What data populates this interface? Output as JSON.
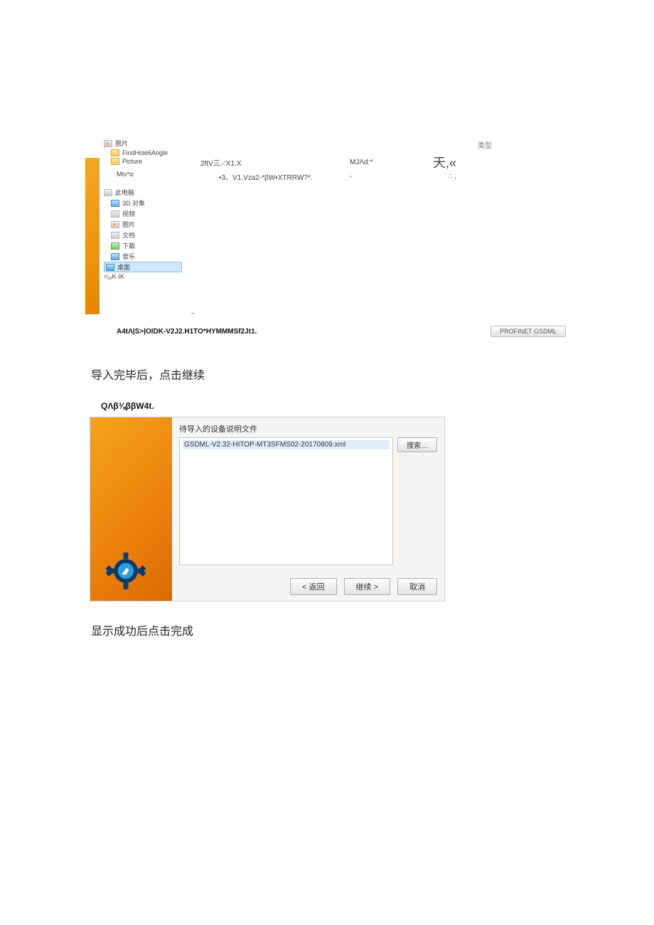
{
  "screenshot1": {
    "tree": {
      "top": [
        {
          "icon": "f-pic f-grey",
          "label": "图片"
        },
        {
          "icon": "f-yellow",
          "label": "FindHole6Angle"
        },
        {
          "icon": "f-yellow",
          "label": "Picture"
        }
      ],
      "rest_label": "Mtv*α",
      "group_header": "此电脑",
      "items": [
        {
          "icon": "f-blue",
          "label": "3D 对象"
        },
        {
          "icon": "f-grey",
          "label": "视频"
        },
        {
          "icon": "f-pic f-grey",
          "label": "图片"
        },
        {
          "icon": "f-grey",
          "label": "文档"
        },
        {
          "icon": "f-green",
          "label": "下载"
        },
        {
          "icon": "f-blue",
          "label": "音乐"
        }
      ],
      "selected": {
        "icon": "f-blue",
        "label": "桌面"
      },
      "tail": "⁷⁄₁₀K·IK"
    },
    "columns": {
      "type": "类型"
    },
    "files": {
      "row1": {
        "name": "2ftV三.-'X1.X",
        "date": "MJΛd:*",
        "size": "天,«"
      },
      "row2": {
        "name": "•3、V1.Vza2-*βW•XTRRW?*.",
        "date": "-",
        "size": "∴ ,"
      }
    },
    "chevron": "⌄",
    "filename_label": "A4tΛ|S>|OIDK-V2J2.H1TO*HYMMMSf2Jt1.",
    "filter": "PROFINET GSDML"
  },
  "para1": "导入完毕后，点击继续",
  "screenshot2": {
    "title": "QΛβ⅜ββW4t.",
    "heading": "待导入的设备说明文件",
    "list_item": "GSDML-V2.32-HITOP-MT3SFMS02-20170809.xml",
    "browse": "搜索…",
    "btn_back": "< 返回",
    "btn_next": "继续 >",
    "btn_cancel": "取消"
  },
  "para2": "显示成功后点击完成"
}
